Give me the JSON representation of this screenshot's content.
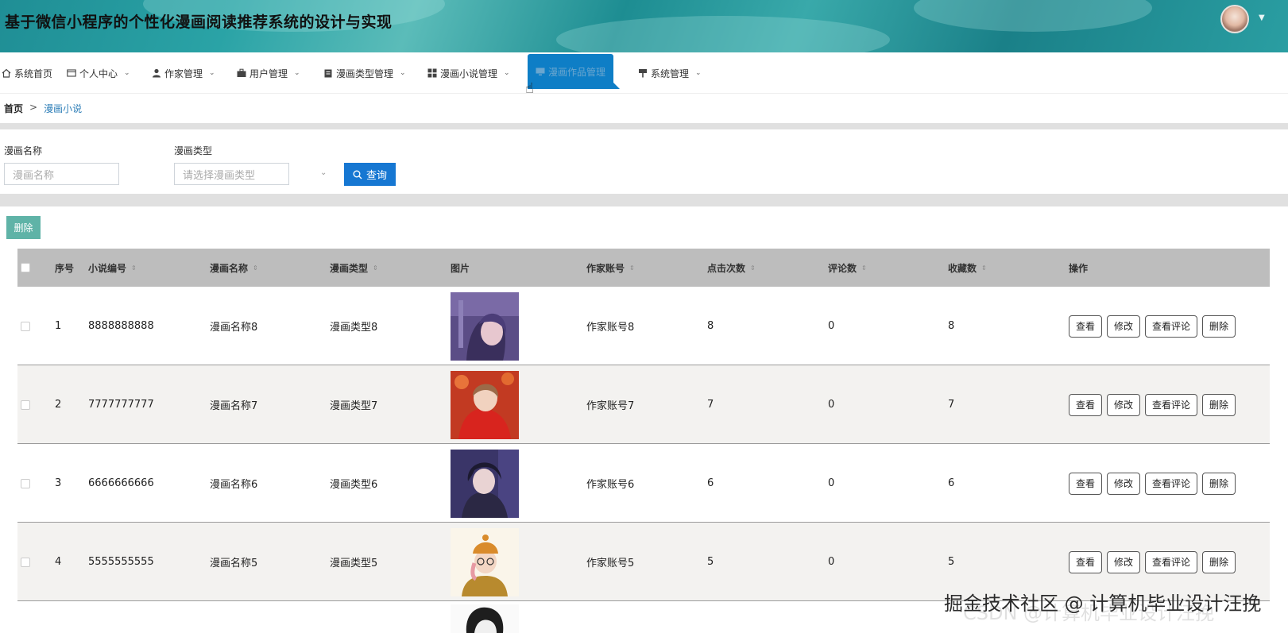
{
  "header": {
    "title": "基于微信小程序的个性化漫画阅读推荐系统的设计与实现"
  },
  "nav": {
    "items": [
      {
        "label": "系统首页",
        "icon": "home-icon"
      },
      {
        "label": "个人中心",
        "icon": "card-icon"
      },
      {
        "label": "作家管理",
        "icon": "user-icon"
      },
      {
        "label": "用户管理",
        "icon": "briefcase-icon"
      },
      {
        "label": "漫画类型管理",
        "icon": "clipboard-icon"
      },
      {
        "label": "漫画小说管理",
        "icon": "grid-icon"
      },
      {
        "label": "漫画作品管理",
        "icon": "monitor-icon"
      },
      {
        "label": "系统管理",
        "icon": "pin-icon"
      }
    ]
  },
  "breadcrumb": {
    "home": "首页",
    "separator": ">",
    "current": "漫画小说"
  },
  "search": {
    "name_label": "漫画名称",
    "name_placeholder": "漫画名称",
    "type_label": "漫画类型",
    "type_placeholder": "请选择漫画类型",
    "query_label": "查询"
  },
  "toolbar": {
    "delete_label": "删除"
  },
  "table": {
    "headers": [
      "序号",
      "小说编号",
      "漫画名称",
      "漫画类型",
      "图片",
      "作家账号",
      "点击次数",
      "评论数",
      "收藏数",
      "操作"
    ],
    "rows": [
      {
        "index": "1",
        "code": "8888888888",
        "name": "漫画名称8",
        "type": "漫画类型8",
        "author": "作家账号8",
        "clicks": "8",
        "comments": "0",
        "favorites": "8"
      },
      {
        "index": "2",
        "code": "7777777777",
        "name": "漫画名称7",
        "type": "漫画类型7",
        "author": "作家账号7",
        "clicks": "7",
        "comments": "0",
        "favorites": "7"
      },
      {
        "index": "3",
        "code": "6666666666",
        "name": "漫画名称6",
        "type": "漫画类型6",
        "author": "作家账号6",
        "clicks": "6",
        "comments": "0",
        "favorites": "6"
      },
      {
        "index": "4",
        "code": "5555555555",
        "name": "漫画名称5",
        "type": "漫画类型5",
        "author": "作家账号5",
        "clicks": "5",
        "comments": "0",
        "favorites": "5"
      }
    ],
    "actions": [
      "查看",
      "修改",
      "查看评论",
      "删除"
    ]
  },
  "watermark": "掘金技术社区 @ 计算机毕业设计汪挽",
  "colors": {
    "header_teal": "#2aa3a6",
    "nav_active": "#0e7ec6",
    "query_button": "#1677d2",
    "delete_button": "#5fb3a7",
    "table_header": "#bdbdbd"
  }
}
